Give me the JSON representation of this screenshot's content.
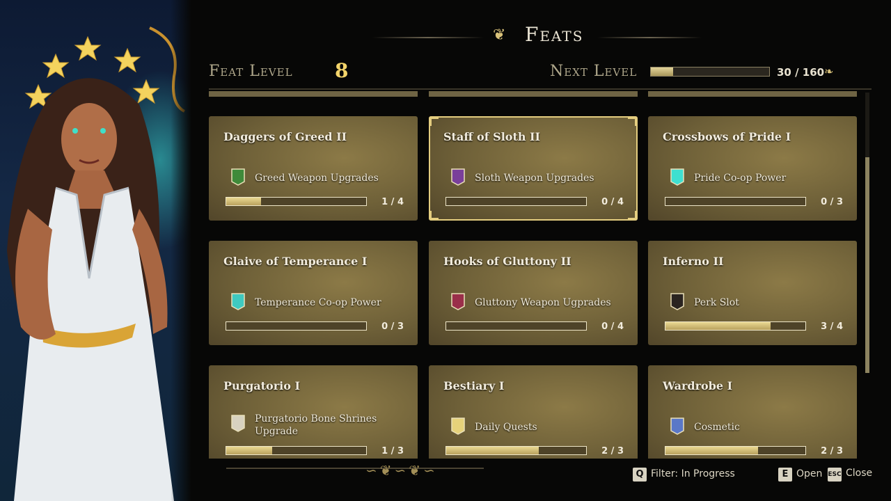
{
  "header": {
    "title": "Feats",
    "feat_level_label": "Feat Level",
    "feat_level_value": "8",
    "next_level_label": "Next Level",
    "xp_text": "30 / 160",
    "xp_progress": 0.19
  },
  "cards": [
    {
      "title": "Daggers of Greed II",
      "icon": "greed-banner-icon",
      "icon_color": "#3f8a3a",
      "desc": "Greed Weapon Upgrades",
      "progress_text": "1 / 4",
      "progress": 0.25
    },
    {
      "title": "Staff of Sloth II",
      "icon": "sloth-banner-icon",
      "icon_color": "#7a3f9a",
      "desc": "Sloth Weapon Upgrades",
      "progress_text": "0 / 4",
      "progress": 0
    },
    {
      "title": "Crossbows of Pride I",
      "icon": "pride-burst-icon",
      "icon_color": "#3fe0d0",
      "desc": "Pride Co-op Power",
      "progress_text": "0 / 3",
      "progress": 0
    },
    {
      "title": "Glaive of Temperance I",
      "icon": "temperance-emblem-icon",
      "icon_color": "#3fc9c0",
      "desc": "Temperance Co-op Power",
      "progress_text": "0 / 3",
      "progress": 0
    },
    {
      "title": "Hooks of Gluttony II",
      "icon": "gluttony-banner-icon",
      "icon_color": "#9a2f4a",
      "desc": "Gluttony Weapon Ugprades",
      "progress_text": "0 / 4",
      "progress": 0
    },
    {
      "title": "Inferno II",
      "icon": "perk-slot-icon",
      "icon_color": "#2a2420",
      "desc": "Perk Slot",
      "progress_text": "3 / 4",
      "progress": 0.75
    },
    {
      "title": "Purgatorio I",
      "icon": "bone-shrine-icon",
      "icon_color": "#d8d2c0",
      "desc": "Purgatorio Bone Shrines Upgrade",
      "progress_text": "1 / 3",
      "progress": 0.33
    },
    {
      "title": "Bestiary I",
      "icon": "quest-scroll-icon",
      "icon_color": "#e6d27a",
      "desc": "Daily Quests",
      "progress_text": "2 / 3",
      "progress": 0.66
    },
    {
      "title": "Wardrobe I",
      "icon": "cosmetic-gem-icon",
      "icon_color": "#5a78c8",
      "desc": "Cosmetic",
      "progress_text": "2 / 3",
      "progress": 0.66
    }
  ],
  "footer": {
    "filter_key": "Q",
    "filter_label": "Filter: In Progress",
    "open_key": "E",
    "open_label": "Open",
    "close_key": "ESC",
    "close_label": "Close"
  }
}
